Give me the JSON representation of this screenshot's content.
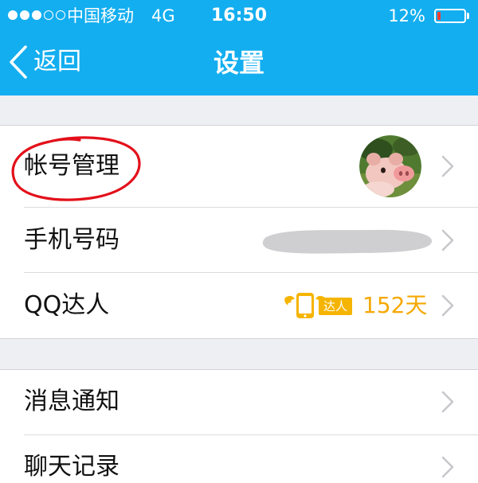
{
  "status_bar": {
    "carrier": "中国移动",
    "network": "4G",
    "time": "16:50",
    "battery_percent": "12%",
    "battery_level": 0.12,
    "signal_bars_filled": 3,
    "signal_bars_total": 5
  },
  "nav": {
    "back_label": "返回",
    "title": "设置",
    "back_icon": "chevron-left-icon"
  },
  "colors": {
    "nav_background": "#13aef0",
    "page_background": "#eeeff3",
    "annotation_red": "#e3101a",
    "daren_gold": "#f5a800",
    "battery_low": "#ff3b30"
  },
  "settings_groups": [
    {
      "rows": [
        {
          "label": "帐号管理",
          "accessory": "avatar",
          "icon": "avatar-icon",
          "annotated_with_red_circle": true
        },
        {
          "label": "手机号码",
          "accessory": "redacted-value"
        },
        {
          "label": "QQ达人",
          "badge_label": "达人",
          "badge_icon": "winged-phone-icon",
          "value": "152天"
        }
      ]
    },
    {
      "rows": [
        {
          "label": "消息通知"
        },
        {
          "label": "聊天记录"
        }
      ]
    }
  ]
}
